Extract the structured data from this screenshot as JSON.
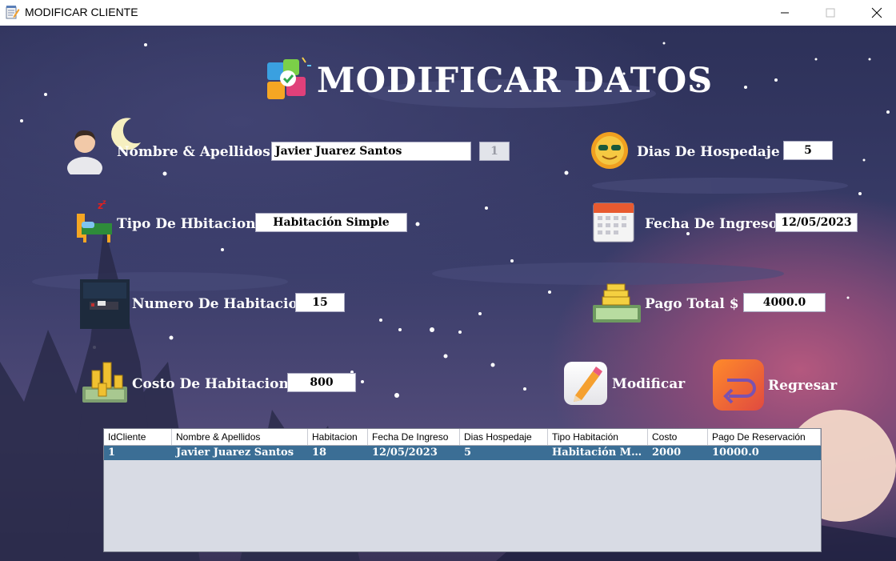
{
  "window": {
    "title": "MODIFICAR CLIENTE",
    "minimize_icon": "minimize-icon",
    "maximize_icon": "maximize-icon",
    "close_icon": "close-icon"
  },
  "heading": "MODIFICAR DATOS",
  "form": {
    "nombre": {
      "label": "Nombre & Apellidos",
      "value": "Javier Juarez Santos",
      "id_value": "1"
    },
    "tipo": {
      "label": "Tipo De Hbitacion",
      "value": "Habitación Simple"
    },
    "numero": {
      "label": "Numero De Habitacion",
      "value": "15"
    },
    "costo": {
      "label": "Costo De Habitacion  $",
      "value": "800"
    },
    "dias": {
      "label": "Dias De Hospedaje",
      "value": "5"
    },
    "fecha": {
      "label": "Fecha De Ingreso",
      "value": "12/05/2023"
    },
    "pago": {
      "label": "Pago Total  $",
      "value": "4000.0"
    }
  },
  "buttons": {
    "modificar": "Modificar",
    "regresar": "Regresar"
  },
  "table": {
    "columns": [
      "IdCliente",
      "Nombre & Apellidos",
      "Habitacion",
      "Fecha De Ingreso",
      "Dias Hospedaje",
      "Tipo Habitación",
      "Costo",
      "Pago De  Reservación"
    ],
    "rows": [
      [
        "1",
        "Javier Juarez Santos",
        "18",
        "12/05/2023",
        "5",
        "Habitación Matrimonial",
        "2000",
        "10000.0"
      ]
    ]
  },
  "colors": {
    "selected_row": "#3b6e95",
    "regresar_button": "#f06030"
  }
}
